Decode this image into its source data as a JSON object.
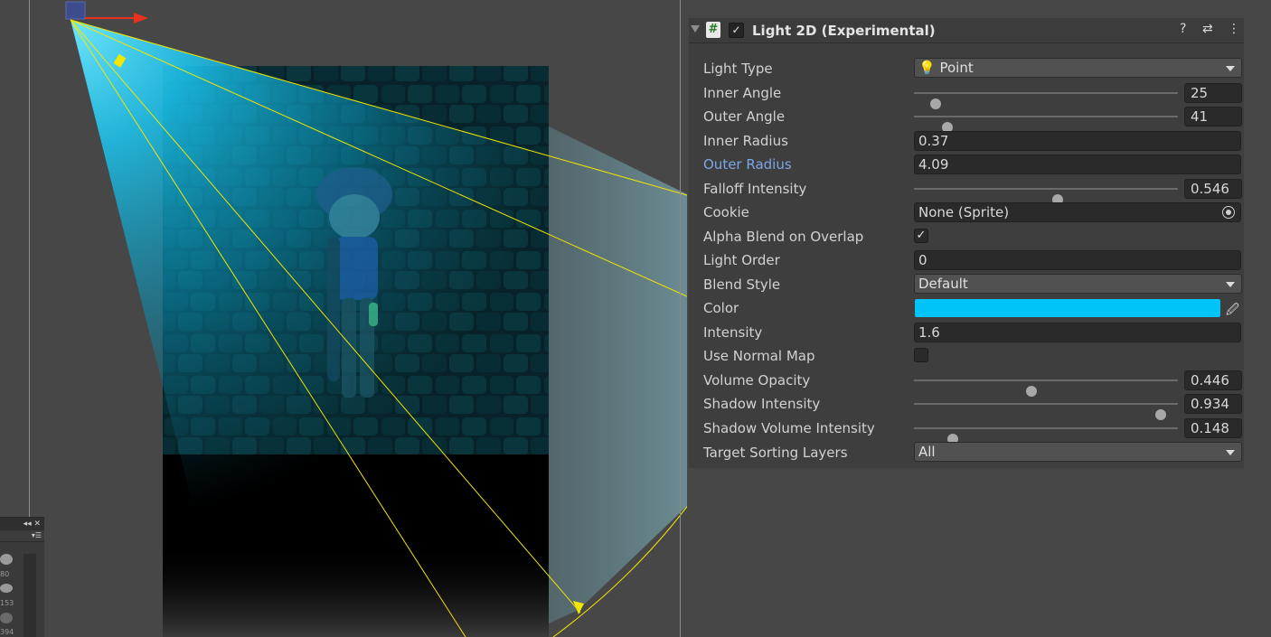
{
  "component": {
    "title": "Light 2D (Experimental)",
    "enabled_glyph": "✓",
    "script_glyph": "#",
    "icons": {
      "help": "?",
      "presets": "⇄",
      "more": "⋮"
    }
  },
  "properties": {
    "light_type": {
      "label": "Light Type",
      "value": "Point",
      "icon": "lightbulb-icon"
    },
    "inner_angle": {
      "label": "Inner Angle",
      "value": "25",
      "fraction": 0.083
    },
    "outer_angle": {
      "label": "Outer Angle",
      "value": "41",
      "fraction": 0.128
    },
    "inner_radius": {
      "label": "Inner Radius",
      "value": "0.37"
    },
    "outer_radius": {
      "label": "Outer Radius",
      "value": "4.09"
    },
    "falloff_intensity": {
      "label": "Falloff Intensity",
      "value": "0.546",
      "fraction": 0.546
    },
    "cookie": {
      "label": "Cookie",
      "value": "None (Sprite)"
    },
    "alpha_blend": {
      "label": "Alpha Blend on Overlap",
      "checked": "✓"
    },
    "light_order": {
      "label": "Light Order",
      "value": "0"
    },
    "blend_style": {
      "label": "Blend Style",
      "value": "Default"
    },
    "color": {
      "label": "Color",
      "value": "#00c3f8"
    },
    "intensity": {
      "label": "Intensity",
      "value": "1.6"
    },
    "use_normal_map": {
      "label": "Use Normal Map",
      "checked": ""
    },
    "volume_opacity": {
      "label": "Volume Opacity",
      "value": "0.446",
      "fraction": 0.446
    },
    "shadow_intensity": {
      "label": "Shadow Intensity",
      "value": "0.934",
      "fraction": 0.934
    },
    "shadow_volume_intensity": {
      "label": "Shadow Volume Intensity",
      "value": "0.148",
      "fraction": 0.148
    },
    "target_sorting_layers": {
      "label": "Target Sorting Layers",
      "value": "All"
    }
  },
  "mini_panel": {
    "header_glyphs": "◂◂ ✕",
    "menu_glyph": "▾☰",
    "numbers": [
      "80",
      "153",
      "394"
    ]
  },
  "colors": {
    "light_cone": "#2fd6ff",
    "gizmo_line": "#f2e600",
    "gizmo_arrow": "#e8321e",
    "handle": "#3c4c8c"
  }
}
